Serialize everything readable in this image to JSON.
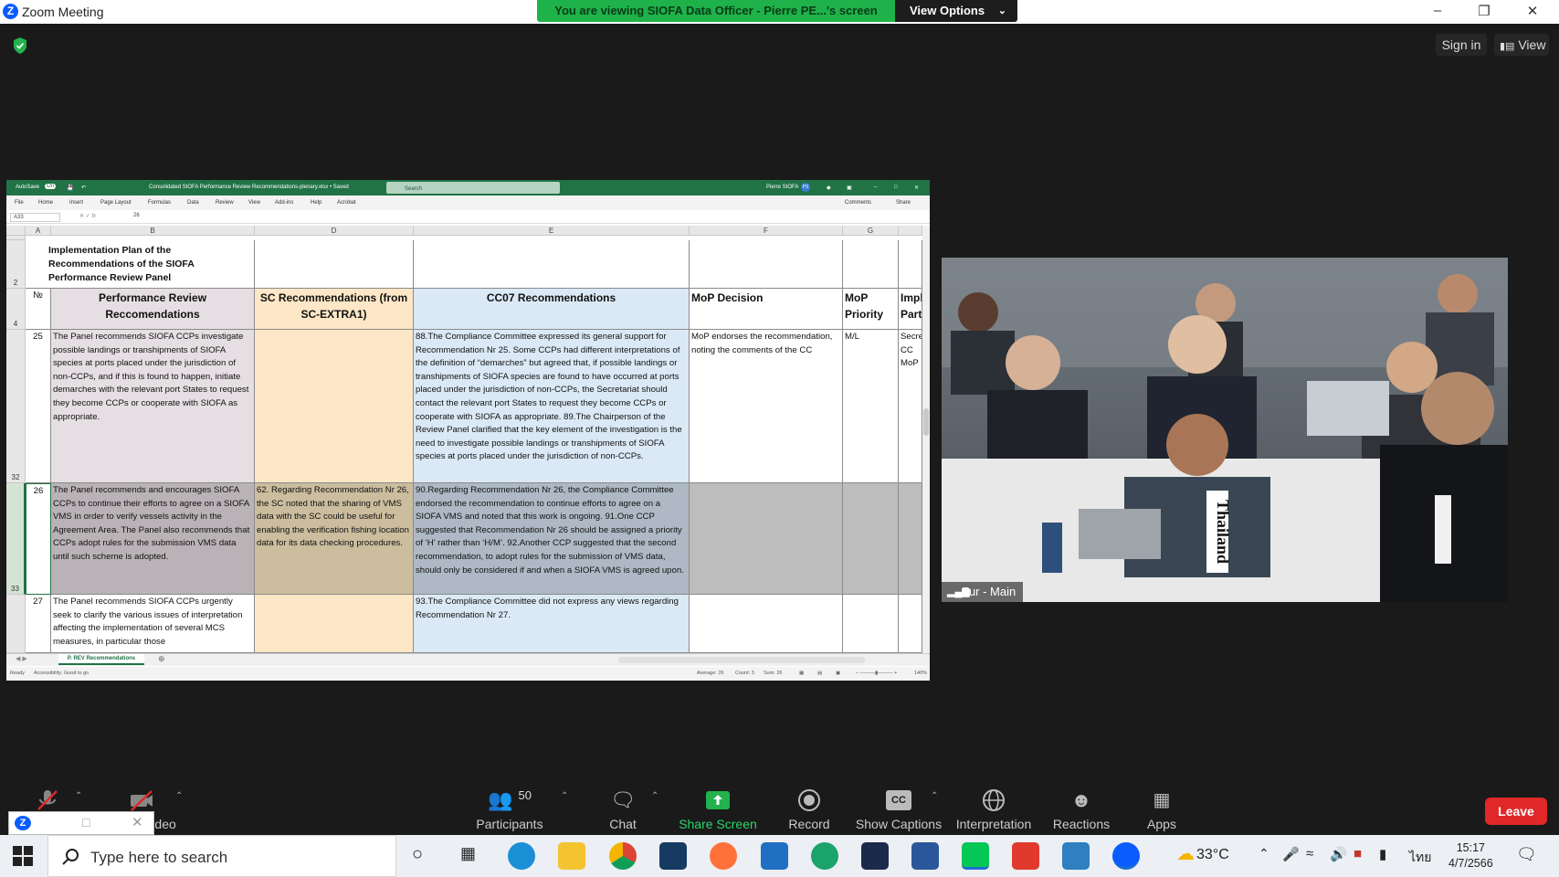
{
  "window": {
    "title": "Zoom Meeting",
    "share_banner": "You are viewing SIOFA Data Officer - Pierre PE...'s screen",
    "view_options": "View Options"
  },
  "top_right": {
    "sign_in": "Sign in",
    "view": "View"
  },
  "excel": {
    "autosave": "AutoSave",
    "autosave_state": "On",
    "filename": "Consolidated SIOFA Performance Review Recommendations-plenary.xlsx • Saved",
    "search_placeholder": "Search",
    "user": "Pierre SIOFA",
    "user_initials": "PS",
    "menus": [
      "File",
      "Home",
      "Insert",
      "Page Layout",
      "Formulas",
      "Data",
      "Review",
      "View",
      "Add-ins",
      "Help",
      "Acrobat"
    ],
    "comments": "Comments",
    "share": "Share",
    "name_box": "A33",
    "formula_value": "26",
    "columns": [
      "A",
      "B",
      "D",
      "E",
      "F",
      "G"
    ],
    "rows": {
      "r1": "1",
      "r2": "2",
      "r4": "4",
      "r32": "32",
      "r33": "33"
    },
    "plan_title": "Implementation Plan of the Recommendations of the SIOFA Performance Review Panel",
    "headers": {
      "no": "№",
      "b": "Performance Review Reccomendations",
      "d": "SC Recommendations (from SC-EXTRA1)",
      "e": "CC07 Recommendations",
      "f": "MoP Decision",
      "g": "MoP Priority",
      "h": "Impl Party"
    },
    "row25": {
      "no": "25",
      "b": "The Panel recommends SIOFA CCPs investigate possible landings or transhipments of SIOFA species at ports placed under the jurisdiction of non-CCPs, and if this is found to happen, initiate demarches with the relevant port States to request they become CCPs or cooperate with SIOFA as appropriate.",
      "d": "",
      "e": "88.The Compliance Committee expressed its general support for Recommendation Nr 25. Some CCPs had different interpretations of the definition of “demarches” but agreed that, if possible landings or transhipments of SIOFA species are found to have occurred at ports placed under the jurisdiction of non-CCPs, the Secretariat should contact the relevant port States to request they become CCPs or cooperate with SIOFA as appropriate. 89.The Chairperson of the Review Panel clarified that the key element of the investigation is the need to investigate possible landings or transhipments of SIOFA species at ports placed under the jurisdiction of non-CCPs.",
      "f": "MoP endorses the recommendation, noting the comments of the CC",
      "g": "M/L",
      "h": "Secret CC MoP"
    },
    "row26": {
      "no": "26",
      "b": "The Panel recommends and encourages SIOFA CCPs to continue their efforts to agree on a SIOFA VMS in order to verify vessels activity in the Agreement Area. The Panel also recommends that CCPs adopt rules for the submission VMS data until such scheme is adopted.",
      "d": "62. Regarding Recommendation Nr 26, the SC noted that the sharing of VMS data with the SC could be useful for enabling the verification fishing location data for its data checking procedures.",
      "e": "90.Regarding Recommendation Nr 26, the Compliance Committee endorsed the recommendation to continue efforts to agree on a SIOFA VMS and noted that this work is ongoing. 91.One CCP suggested that Recommendation Nr 26 should be assigned a priority of ‘H’ rather than ‘H/M’. 92.Another CCP suggested that the second recommendation, to adopt rules for the submission of VMS data, should only be considered if and when a SIOFA VMS is agreed upon.",
      "f": "",
      "g": "",
      "h": ""
    },
    "row27": {
      "no": "27",
      "b": "The Panel recommends SIOFA CCPs urgently seek to clarify the various issues of interpretation affecting the implementation of several MCS measures, in particular those",
      "d": "",
      "e": "93.The Compliance Committee did not express any views regarding Recommendation Nr 27.",
      "f": "",
      "g": "",
      "h": ""
    },
    "sheet_tab": "P. REV Recommendations",
    "status_ready": "Ready",
    "status_accessibility": "Accessibility: Good to go",
    "status_average": "Average: 26",
    "status_count": "Count: 3",
    "status_sum": "Sum: 26",
    "zoom": "140%"
  },
  "video": {
    "participant_label": "Fur - Main",
    "placard_text": "Thailand"
  },
  "toolbar": {
    "video_label": "Video",
    "participants_label": "Participants",
    "participants_count": "50",
    "chat_label": "Chat",
    "share_label": "Share Screen",
    "record_label": "Record",
    "captions_label": "Show Captions",
    "captions_icon_text": "CC",
    "interpretation_label": "Interpretation",
    "reactions_label": "Reactions",
    "apps_label": "Apps",
    "leave_label": "Leave"
  },
  "taskbar": {
    "search_placeholder": "Type here to search",
    "temperature": "33°C",
    "language": "ไทย",
    "time": "15:17",
    "date": "4/7/2566"
  },
  "colors": {
    "zoom_blue": "#0b5cff",
    "banner_green": "#1fb24a",
    "excel_green": "#217346",
    "leave_red": "#e02828",
    "share_green": "#2bd56a"
  }
}
